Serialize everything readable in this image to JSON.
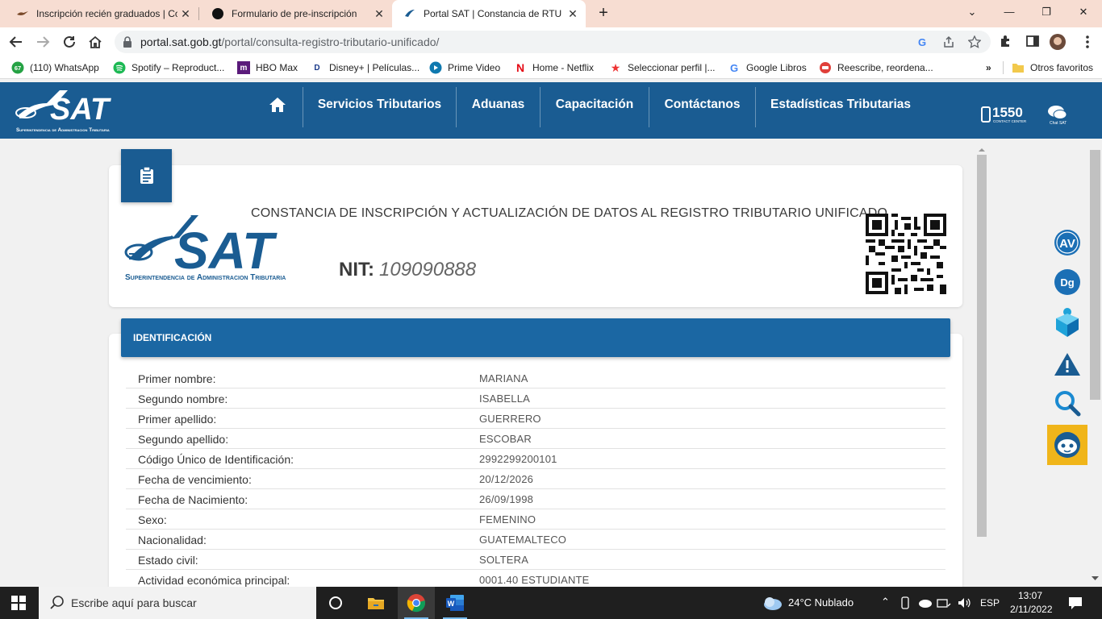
{
  "browser": {
    "tabs": [
      {
        "title": "Inscripción recién graduados | Co",
        "active": false
      },
      {
        "title": "Formulario de pre-inscripción",
        "active": false
      },
      {
        "title": "Portal SAT | Constancia de RTU D",
        "active": true
      }
    ],
    "url_host": "portal.sat.gob.gt",
    "url_path": "/portal/consulta-registro-tributario-unificado/",
    "bookmarks": [
      "(110) WhatsApp",
      "Spotify – Reproduct...",
      "HBO Max",
      "Disney+ | Películas...",
      "Prime Video",
      "Home - Netflix",
      "Seleccionar perfil |...",
      "Google Libros",
      "Reescribe, reordena...",
      "Otros favoritos"
    ],
    "whatsapp_badge": "67"
  },
  "sat": {
    "logo_text": "SAT",
    "logo_subtitle": "Superintendencia de Administracion Tributaria",
    "nav": [
      "Servicios Tributarios",
      "Aduanas",
      "Capacitación",
      "Contáctanos",
      "Estadísticas Tributarias"
    ],
    "contact_center_number": "1550",
    "contact_center_label": "CONTACT CENTER",
    "chat_label": "Chat SAT",
    "colors": {
      "primary": "#1a5c92",
      "section": "#1b67a3"
    }
  },
  "document": {
    "title": "CONSTANCIA DE INSCRIPCIÓN Y ACTUALIZACIÓN DE DATOS AL REGISTRO TRIBUTARIO UNIFICADO",
    "nit_label": "NIT:",
    "nit_value": "109090888",
    "section_title": "IDENTIFICACIÓN",
    "fields": [
      {
        "label": "Primer nombre:",
        "value": "MARIANA"
      },
      {
        "label": "Segundo nombre:",
        "value": "ISABELLA"
      },
      {
        "label": "Primer apellido:",
        "value": "GUERRERO"
      },
      {
        "label": "Segundo apellido:",
        "value": "ESCOBAR"
      },
      {
        "label": "Código Único de Identificación:",
        "value": "2992299200101"
      },
      {
        "label": "Fecha de vencimiento:",
        "value": "20/12/2026"
      },
      {
        "label": "Fecha de Nacimiento:",
        "value": "26/09/1998"
      },
      {
        "label": "Sexo:",
        "value": "FEMENINO"
      },
      {
        "label": "Nacionalidad:",
        "value": "GUATEMALTECO"
      },
      {
        "label": "Estado civil:",
        "value": "SOLTERA"
      },
      {
        "label": "Actividad económica principal:",
        "value": "0001.40 ESTUDIANTE"
      }
    ]
  },
  "taskbar": {
    "search_placeholder": "Escribe aquí para buscar",
    "weather": "24°C  Nublado",
    "language": "ESP",
    "time": "13:07",
    "date": "2/11/2022"
  }
}
